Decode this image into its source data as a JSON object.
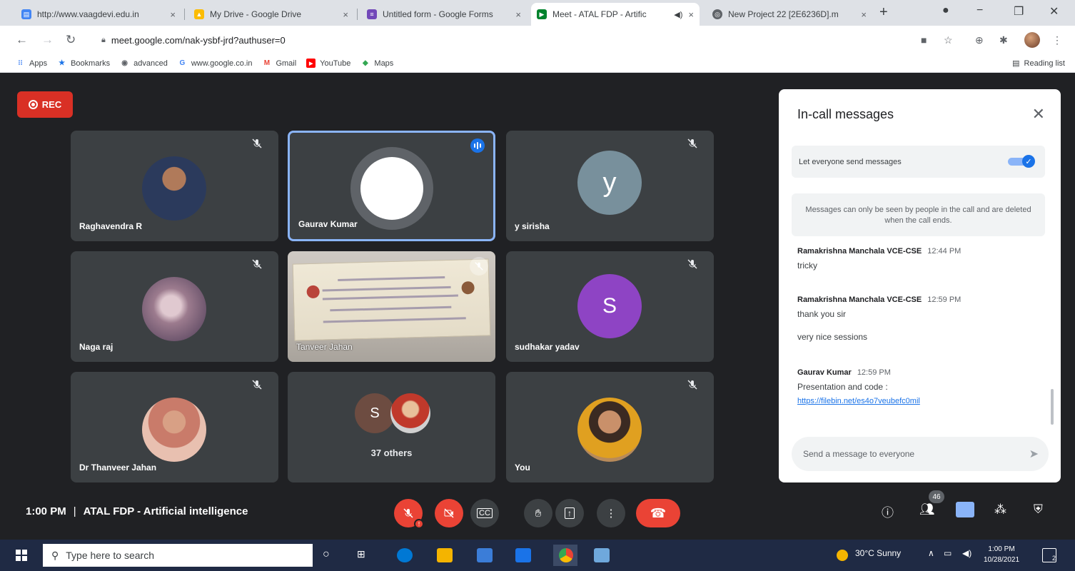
{
  "browser": {
    "tabs": [
      {
        "title": "http://www.vaagdevi.edu.in",
        "color": "#4285f4",
        "active": false
      },
      {
        "title": "My Drive - Google Drive",
        "color": "#fbbc04",
        "active": false
      },
      {
        "title": "Untitled form - Google Forms",
        "color": "#7248b9",
        "active": false
      },
      {
        "title": "Meet - ATAL FDP - Artific",
        "color": "#00832d",
        "active": true
      },
      {
        "title": "New Project 22 [2E6236D].m",
        "color": "#5f6368",
        "active": false
      }
    ],
    "tab_close": "×",
    "new_tab": "+",
    "url": "meet.google.com/nak-ysbf-jrd?authuser=0",
    "bookmarks": [
      {
        "label": "Apps",
        "icon": "apps-grid-icon",
        "color": "#4285f4"
      },
      {
        "label": "Bookmarks",
        "icon": "star-icon",
        "color": "#1a73e8"
      },
      {
        "label": "advanced",
        "icon": "globe-icon",
        "color": "#5f6368"
      },
      {
        "label": "www.google.co.in",
        "icon": "google-icon",
        "color": "#4285f4"
      },
      {
        "label": "Gmail",
        "icon": "gmail-icon",
        "color": "#ea4335"
      },
      {
        "label": "YouTube",
        "icon": "youtube-icon",
        "color": "#ff0000"
      },
      {
        "label": "Maps",
        "icon": "maps-icon",
        "color": "#34a853"
      }
    ],
    "reading_list": "Reading list"
  },
  "meet": {
    "rec_label": "REC",
    "participants": [
      {
        "name": "Raghavendra R",
        "avatar_type": "photo",
        "avatar_color": "#2b3a5c",
        "muted": true
      },
      {
        "name": "Gaurav Kumar",
        "avatar_type": "blank",
        "avatar_color": "#ffffff",
        "speaking": true
      },
      {
        "name": "y sirisha",
        "avatar_type": "letter",
        "letter": "y",
        "avatar_color": "#78909c",
        "muted": true
      },
      {
        "name": "Naga raj",
        "avatar_type": "photo",
        "avatar_color": "#7d6a8a",
        "muted": true
      },
      {
        "name": "Tanveer Jahan",
        "avatar_type": "video",
        "muted": true
      },
      {
        "name": "sudhakar yadav",
        "avatar_type": "letter",
        "letter": "S",
        "avatar_color": "#8e44c4",
        "muted": true
      },
      {
        "name": "Dr Thanveer Jahan",
        "avatar_type": "photo",
        "avatar_color": "#c97b6a",
        "muted": true
      },
      {
        "name": "37 others",
        "avatar_type": "group",
        "letter": "S",
        "avatar_color": "#6d4c41"
      },
      {
        "name": "You",
        "avatar_type": "photo",
        "avatar_color": "#b78a5a",
        "muted": true
      }
    ],
    "time": "1:00 PM",
    "separator": "|",
    "meeting_title": "ATAL FDP - Artificial intelligence",
    "people_count": "46"
  },
  "chat": {
    "title": "In-call messages",
    "setting_label": "Let everyone send messages",
    "notice": "Messages can only be seen by people in the call and are deleted when the call ends.",
    "messages": [
      {
        "sender": "Ramakrishna Manchala VCE-CSE",
        "time": "12:44 PM",
        "lines": [
          "tricky"
        ]
      },
      {
        "sender": "Ramakrishna Manchala VCE-CSE",
        "time": "12:59 PM",
        "lines": [
          "thank you sir",
          "very nice sessions"
        ]
      },
      {
        "sender": "Gaurav Kumar",
        "time": "12:59 PM",
        "lines": [
          "Presentation and code :"
        ],
        "link": "https://filebin.net/es4o7veubefc0mil"
      }
    ],
    "input_placeholder": "Send a message to everyone"
  },
  "taskbar": {
    "search_placeholder": "Type here to search",
    "weather": "30°C  Sunny",
    "clock_time": "1:00 PM",
    "clock_date": "10/28/2021",
    "notification_count": "2"
  }
}
